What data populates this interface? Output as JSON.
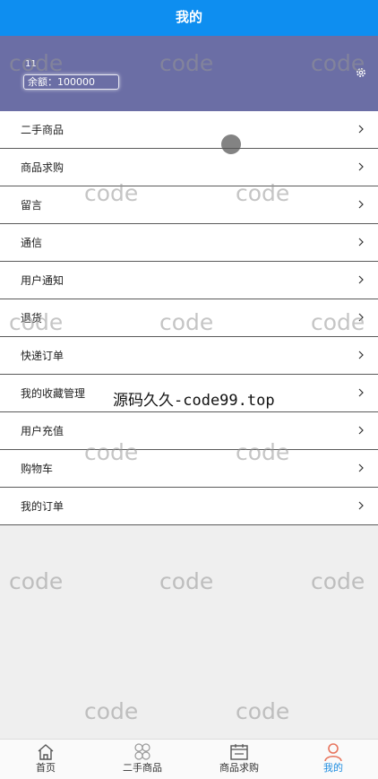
{
  "header": {
    "title": "我的"
  },
  "profile": {
    "username": "11",
    "balance": "余额：100000",
    "settings_icon": "gear-icon"
  },
  "menu": [
    {
      "label": "二手商品"
    },
    {
      "label": "商品求购"
    },
    {
      "label": "留言"
    },
    {
      "label": "通信"
    },
    {
      "label": "用户通知"
    },
    {
      "label": "退货"
    },
    {
      "label": "快递订单"
    },
    {
      "label": "我的收藏管理"
    },
    {
      "label": "用户充值"
    },
    {
      "label": "购物车"
    },
    {
      "label": "我的订单"
    }
  ],
  "watermark": {
    "text": "code",
    "site": "源码久久-code99.top"
  },
  "tabbar": {
    "items": [
      {
        "label": "首页",
        "icon": "home-icon"
      },
      {
        "label": "二手商品",
        "icon": "grid-icon"
      },
      {
        "label": "商品求购",
        "icon": "calendar-icon"
      },
      {
        "label": "我的",
        "icon": "user-icon",
        "active": true
      }
    ]
  },
  "colors": {
    "header": "#0e8ef0",
    "profile_bg": "#6b6ea5",
    "active_tab": "#1f8de0",
    "active_icon": "#e8755e"
  }
}
